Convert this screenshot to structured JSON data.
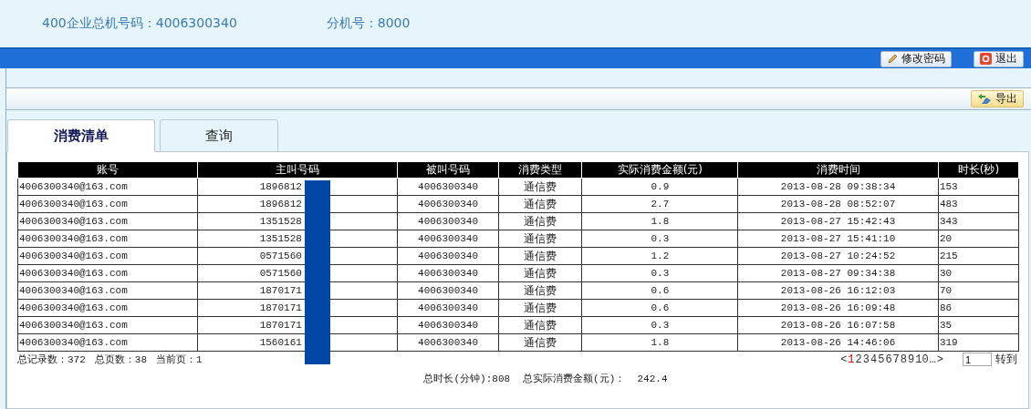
{
  "header": {
    "main_number_label": "400企业总机号码：4006300340",
    "extension_label": "分机号：8000"
  },
  "top_buttons": [
    {
      "kind": "edit",
      "label": "修改密码"
    },
    {
      "kind": "exit",
      "label": "退出"
    }
  ],
  "toolbar": {
    "export_button": "导出"
  },
  "tabs": [
    {
      "label": "消费清单",
      "selected": true
    },
    {
      "label": "查询",
      "selected": false
    }
  ],
  "table": {
    "columns": [
      "账号",
      "主叫号码",
      "被叫号码",
      "消费类型",
      "实际消费金额(元)",
      "消费时间",
      "时长(秒)"
    ],
    "rows": [
      [
        "4006300340@163.com",
        "1896812",
        "4006300340",
        "通信费",
        "0.9",
        "2013-08-28 09:38:34",
        "153"
      ],
      [
        "4006300340@163.com",
        "1896812",
        "4006300340",
        "通信费",
        "2.7",
        "2013-08-28 08:52:07",
        "483"
      ],
      [
        "4006300340@163.com",
        "1351528",
        "4006300340",
        "通信费",
        "1.8",
        "2013-08-27 15:42:43",
        "343"
      ],
      [
        "4006300340@163.com",
        "1351528",
        "4006300340",
        "通信费",
        "0.3",
        "2013-08-27 15:41:10",
        "20"
      ],
      [
        "4006300340@163.com",
        "0571560",
        "4006300340",
        "通信费",
        "1.2",
        "2013-08-27 10:24:52",
        "215"
      ],
      [
        "4006300340@163.com",
        "0571560",
        "4006300340",
        "通信费",
        "0.3",
        "2013-08-27 09:34:38",
        "30"
      ],
      [
        "4006300340@163.com",
        "1870171",
        "4006300340",
        "通信费",
        "0.6",
        "2013-08-26 16:12:03",
        "70"
      ],
      [
        "4006300340@163.com",
        "1870171",
        "4006300340",
        "通信费",
        "0.6",
        "2013-08-26 16:09:48",
        "86"
      ],
      [
        "4006300340@163.com",
        "1870171",
        "4006300340",
        "通信费",
        "0.3",
        "2013-08-26 16:07:58",
        "35"
      ],
      [
        "4006300340@163.com",
        "1560161",
        "4006300340",
        "通信费",
        "1.8",
        "2013-08-26 14:46:06",
        "319"
      ]
    ]
  },
  "summary": {
    "record_count": "总记录数：372",
    "page_count": "总页数：38",
    "current_page": "当前页：1"
  },
  "pagination": {
    "prev": "<",
    "pages": [
      {
        "label": "1",
        "selected": true
      },
      {
        "label": "2",
        "selected": false
      },
      {
        "label": "3",
        "selected": false
      },
      {
        "label": "4",
        "selected": false
      },
      {
        "label": "5",
        "selected": false
      },
      {
        "label": "6",
        "selected": false
      },
      {
        "label": "7",
        "selected": false
      },
      {
        "label": "8",
        "selected": false
      },
      {
        "label": "9",
        "selected": false
      },
      {
        "label": "10",
        "selected": false
      }
    ],
    "more": "…",
    "next": ">",
    "goto_value": "1",
    "goto_button": "转到"
  },
  "totals": {
    "duration": "总时长(分钟):808",
    "amount": "总实际消费金额(元)：  242.4"
  }
}
